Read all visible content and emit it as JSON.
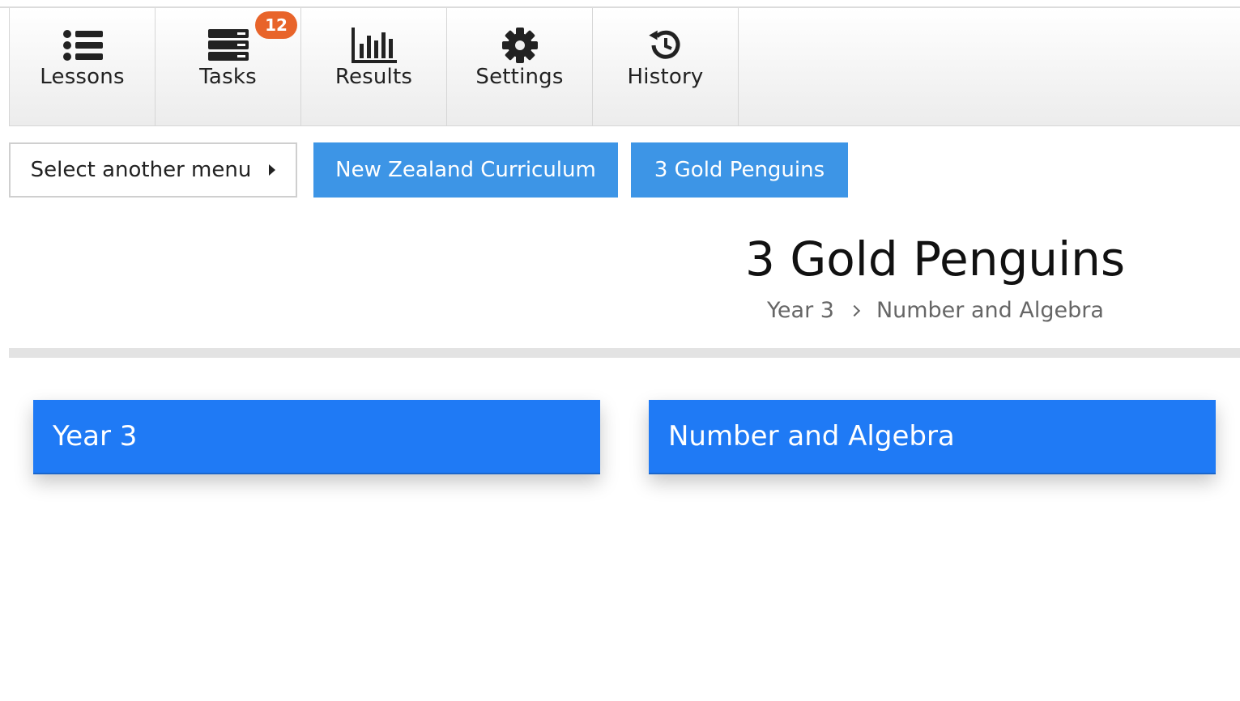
{
  "nav": {
    "items": [
      {
        "label": "Lessons",
        "icon": "list-icon"
      },
      {
        "label": "Tasks",
        "icon": "server-icon",
        "badge": "12"
      },
      {
        "label": "Results",
        "icon": "bar-chart-icon"
      },
      {
        "label": "Settings",
        "icon": "gear-icon"
      },
      {
        "label": "History",
        "icon": "history-icon"
      }
    ]
  },
  "menu": {
    "select_label": "Select another menu",
    "curriculum_label": "New Zealand Curriculum",
    "group_label": "3 Gold Penguins"
  },
  "page": {
    "title": "3 Gold Penguins",
    "breadcrumb": [
      "Year 3",
      "Number and Algebra"
    ]
  },
  "cards": [
    {
      "label": "Year 3"
    },
    {
      "label": "Number and Algebra"
    }
  ],
  "colors": {
    "button_blue": "#3d95e6",
    "card_blue": "#1f7af5",
    "badge_orange": "#e8642a"
  }
}
